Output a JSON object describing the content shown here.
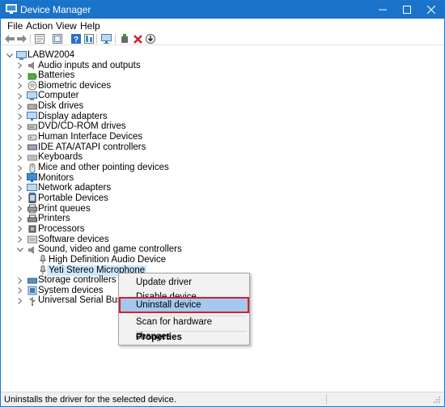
{
  "window": {
    "title": "Device Manager",
    "accent": "#1a73c9"
  },
  "menu": [
    "File",
    "Action",
    "View",
    "Help"
  ],
  "toolbar_icons": [
    "back-arrow-icon",
    "forward-arrow-icon",
    "properties-icon",
    "show-hidden-icon",
    "help-icon",
    "resources-icon",
    "monitor-icon",
    "add-driver-icon",
    "uninstall-x-icon",
    "update-driver-icon"
  ],
  "tree": {
    "root": "LABW2004",
    "categories": [
      "Audio inputs and outputs",
      "Batteries",
      "Biometric devices",
      "Computer",
      "Disk drives",
      "Display adapters",
      "DVD/CD-ROM drives",
      "Human Interface Devices",
      "IDE ATA/ATAPI controllers",
      "Keyboards",
      "Mice and other pointing devices",
      "Monitors",
      "Network adapters",
      "Portable Devices",
      "Print queues",
      "Printers",
      "Processors",
      "Software devices",
      "Sound, video and game controllers"
    ],
    "sound_children": [
      "High Definition Audio Device",
      "Yeti Stereo Microphone"
    ],
    "after": [
      "Storage controllers",
      "System devices",
      "Universal Serial Bus controllers"
    ]
  },
  "context_menu": {
    "items": [
      "Update driver",
      "Disable device",
      "Uninstall device",
      "Scan for hardware changes",
      "Properties"
    ],
    "highlighted": "Uninstall device"
  },
  "status": {
    "text": "Uninstalls the driver for the selected device."
  },
  "colors": {
    "highlight_outline": "#d6202a",
    "selection": "#cce8ff",
    "menu_hover": "#a3c9f1"
  }
}
